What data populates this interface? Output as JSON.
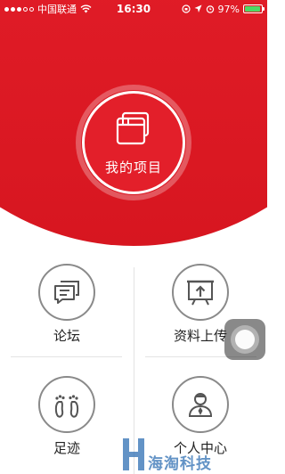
{
  "status_bar": {
    "carrier": "中国联通",
    "time": "16:30",
    "battery_percent": "97%",
    "battery_level": 0.97,
    "signal_bars_on": 3,
    "signal_bars_total": 5
  },
  "hero": {
    "main_button_label": "我的项目",
    "colors": {
      "brand_red": "#e21d28"
    }
  },
  "menu": [
    {
      "label": "论坛",
      "icon": "chat-bubbles-icon"
    },
    {
      "label": "资料上传",
      "icon": "upload-board-icon"
    },
    {
      "label": "足迹",
      "icon": "footprints-icon"
    },
    {
      "label": "个人中心",
      "icon": "user-profile-icon"
    }
  ],
  "watermark": {
    "text": "海淘科技"
  }
}
